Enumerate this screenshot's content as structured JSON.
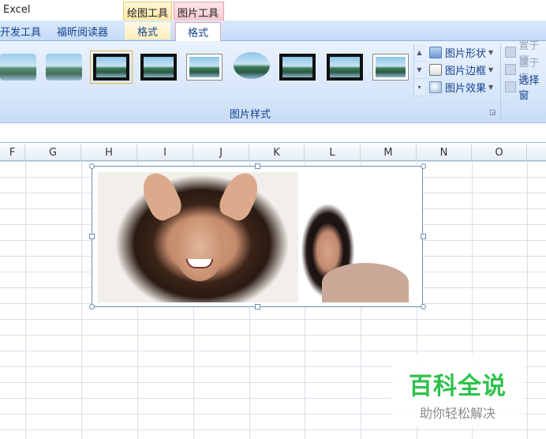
{
  "window": {
    "app_title": "Excel"
  },
  "context_tabs": {
    "drawing_tools": "绘图工具",
    "picture_tools": "图片工具"
  },
  "ribbon_tabs": {
    "developer": "开发工具",
    "foxit_reader": "福昕阅读器",
    "format_drawing": "格式",
    "format_picture": "格式"
  },
  "picture_styles": {
    "group_label": "图片样式",
    "commands": {
      "shape": "图片形状",
      "border": "图片边框",
      "effect": "图片效果"
    }
  },
  "arrange": {
    "bring_forward": "置于顶",
    "send_backward": "置于底",
    "selection_pane": "选择窗"
  },
  "columns": [
    "F",
    "G",
    "H",
    "I",
    "J",
    "K",
    "L",
    "M",
    "N",
    "O"
  ],
  "watermark": {
    "title": "百科全说",
    "subtitle": "助你轻松解决"
  }
}
